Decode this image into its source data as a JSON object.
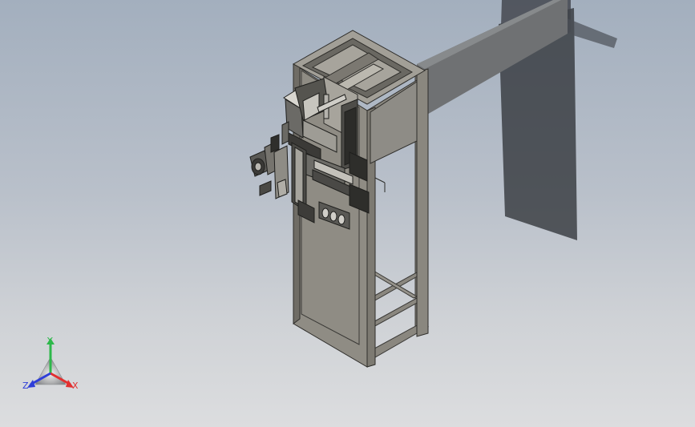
{
  "viewport": {
    "background_top": "#a3afbe",
    "background_bottom": "#dcdddf"
  },
  "model": {
    "frame_color": "#85827a",
    "panel_color": "#8f8d86",
    "shadow_color": "#3c3f44"
  },
  "triad": {
    "x_label": "X",
    "y_label": "Y",
    "z_label": "Z",
    "x_color": "#e23030",
    "y_color": "#2db84a",
    "z_color": "#2f3fd8"
  }
}
